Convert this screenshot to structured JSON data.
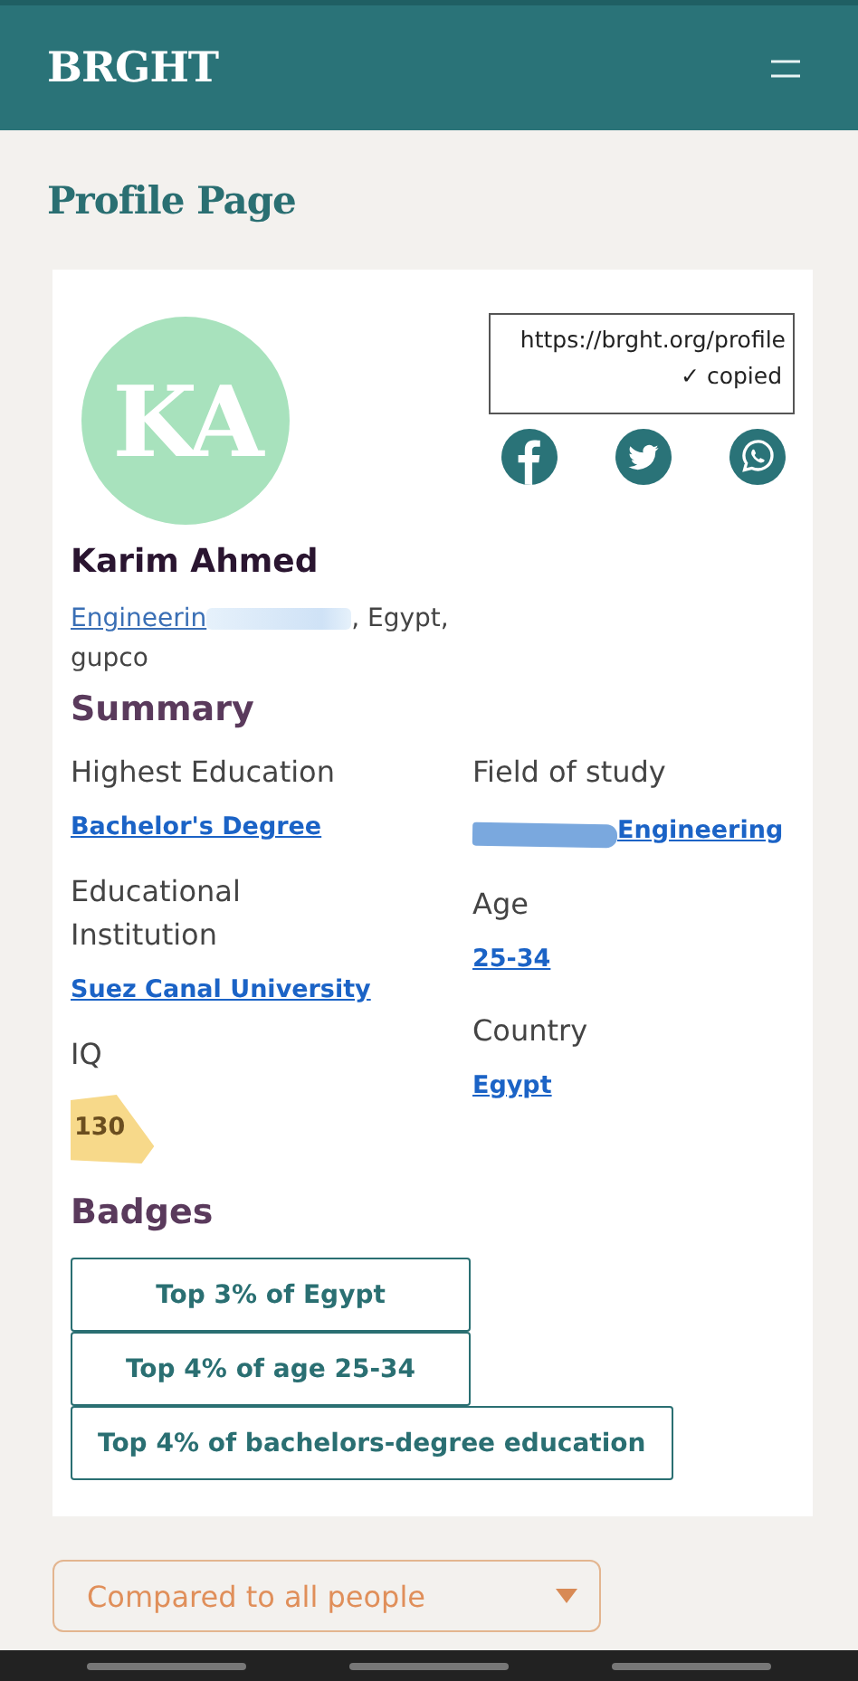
{
  "header": {
    "logo": "BRGHT"
  },
  "page_title": "Profile Page",
  "profile": {
    "initials": "KA",
    "share_url": "https://brght.org/profile",
    "copied_label": "✓ copied",
    "name": "Karim Ahmed",
    "location_link": "Engineerin",
    "location_redacted": true,
    "location_text": ", Egypt, gupco"
  },
  "summary": {
    "heading": "Summary",
    "left": [
      {
        "label": "Highest Education",
        "value": "Bachelor's Degree",
        "redacted": false,
        "highlighted": false
      },
      {
        "label": "Educational Institution",
        "value": "Suez Canal University",
        "redacted": false,
        "highlighted": false
      },
      {
        "label": "IQ",
        "value": "130",
        "redacted": false,
        "highlighted": true
      }
    ],
    "right": [
      {
        "label": "Field of study",
        "value": "Engineering",
        "redacted": true,
        "highlighted": false
      },
      {
        "label": "Age",
        "value": "25-34",
        "redacted": false,
        "highlighted": false
      },
      {
        "label": "Country",
        "value": "Egypt",
        "redacted": false,
        "highlighted": false
      }
    ]
  },
  "badges": {
    "heading": "Badges",
    "items": [
      "Top 3% of Egypt",
      "Top 4% of age 25-34",
      "Top 4% of bachelors-degree education"
    ]
  },
  "dropdown": {
    "label": "Compared to all people"
  }
}
